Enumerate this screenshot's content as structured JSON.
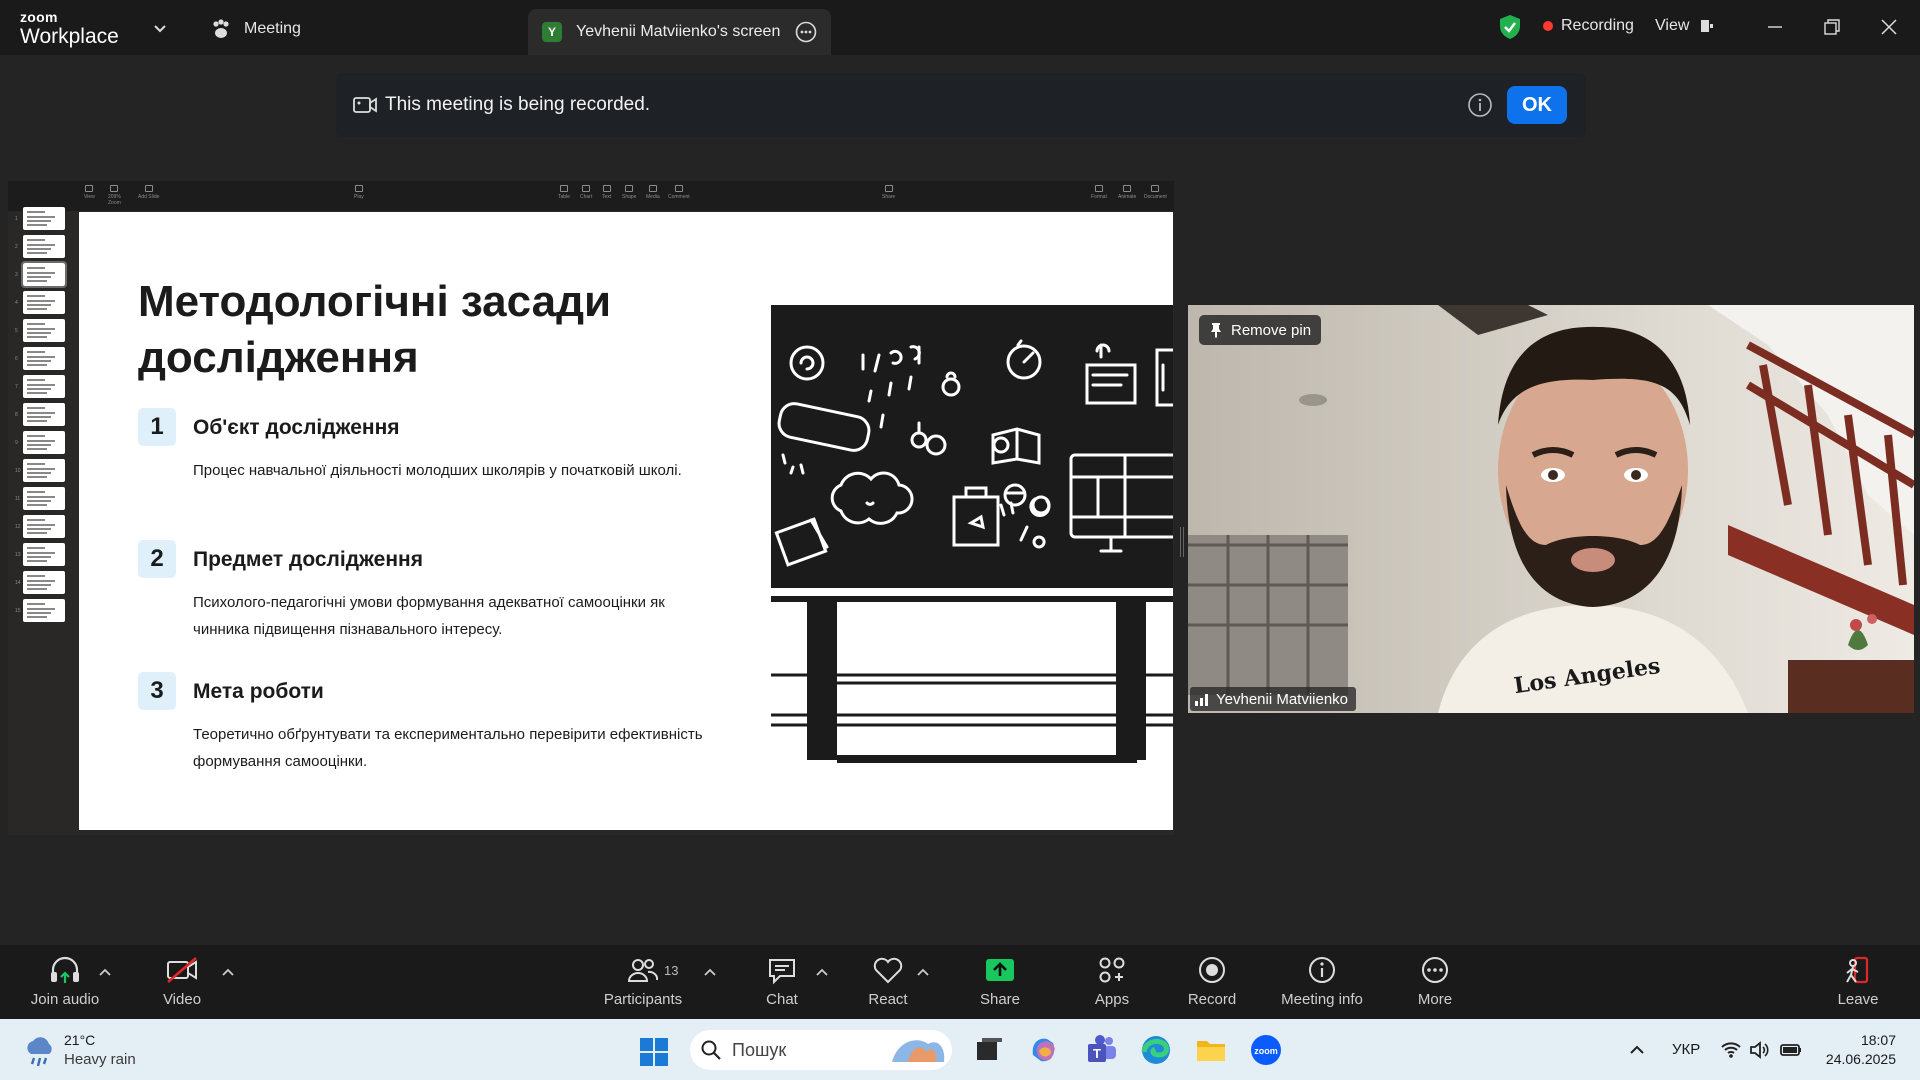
{
  "titlebar": {
    "brand_top": "zoom",
    "brand_bottom": "Workplace",
    "meeting_tab": "Meeting",
    "screen_tab_avatar": "Y",
    "screen_tab_label": "Yevhenii Matviienko's screen",
    "recording_label": "Recording",
    "view_label": "View",
    "icons": [
      "chevron-down-icon",
      "paw-icon",
      "more-icon",
      "shield-check-icon",
      "minimize-icon",
      "restore-icon",
      "close-icon"
    ]
  },
  "banner": {
    "message": "This meeting is being recorded.",
    "ok_label": "OK"
  },
  "shared_screen": {
    "toolbar_items": [
      "View",
      "Zoom",
      "Add Slide",
      "Play",
      "Table",
      "Chart",
      "Text",
      "Shape",
      "Media",
      "Comment",
      "Share",
      "Format",
      "Animate",
      "Document"
    ],
    "zoom_value": "209%",
    "thumbnail_numbers": [
      "1",
      "2",
      "3",
      "4",
      "5",
      "6",
      "7",
      "8",
      "9",
      "10",
      "11",
      "12",
      "13",
      "14",
      "15"
    ],
    "slide": {
      "title": "Методологічні засади дослідження",
      "items": [
        {
          "num": "1",
          "title": "Об'єкт дослідження",
          "desc": "Процес навчальної діяльності молодших школярів у початковій школі."
        },
        {
          "num": "2",
          "title": "Предмет дослідження",
          "desc": "Психолого-педагогічні умови формування адекватної самооцінки як чинника підвищення пізнавального інтересу."
        },
        {
          "num": "3",
          "title": "Мета роботи",
          "desc": "Теоретично обґрунтувати та експериментально перевірити ефективність формування самооцінки."
        }
      ]
    }
  },
  "video": {
    "pin_label": "Remove pin",
    "participant_name": "Yevhenii Matviienko",
    "shirt_text": "Los Angeles"
  },
  "toolbar": {
    "join_audio": "Join audio",
    "video": "Video",
    "participants": "Participants",
    "participants_count": "13",
    "chat": "Chat",
    "react": "React",
    "share": "Share",
    "apps": "Apps",
    "record": "Record",
    "meeting_info": "Meeting info",
    "more": "More",
    "leave": "Leave",
    "colors": {
      "share": "#19c75f",
      "leave": "#e02828"
    }
  },
  "taskbar": {
    "temperature": "21°C",
    "weather": "Heavy rain",
    "search_placeholder": "Пошук",
    "language": "УКР",
    "time": "18:07",
    "date": "24.06.2025"
  }
}
